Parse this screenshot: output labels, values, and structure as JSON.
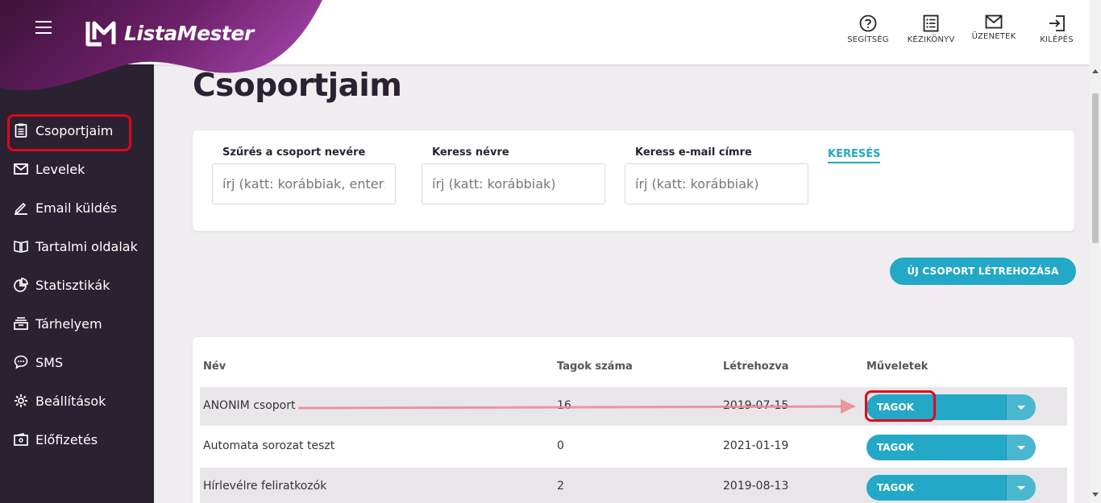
{
  "app": {
    "name": "ListaMester"
  },
  "header": {
    "actions": [
      {
        "label": "SEGÍTSÉG",
        "icon": "help-icon"
      },
      {
        "label": "KÉZIKÖNYV",
        "icon": "manual-icon"
      },
      {
        "label": "ÜZENETEK",
        "icon": "mail-icon"
      },
      {
        "label": "KILÉPÉS",
        "icon": "logout-icon"
      }
    ]
  },
  "sidebar": {
    "items": [
      {
        "label": "Csoportjaim",
        "icon": "clipboard-icon",
        "active": true
      },
      {
        "label": "Levelek",
        "icon": "envelope-icon"
      },
      {
        "label": "Email küldés",
        "icon": "pencil-icon"
      },
      {
        "label": "Tartalmi oldalak",
        "icon": "book-icon"
      },
      {
        "label": "Statisztikák",
        "icon": "pie-chart-icon"
      },
      {
        "label": "Tárhelyem",
        "icon": "storage-icon"
      },
      {
        "label": "SMS",
        "icon": "chat-icon"
      },
      {
        "label": "Beállítások",
        "icon": "gear-icon"
      },
      {
        "label": "Előfizetés",
        "icon": "wallet-icon"
      }
    ]
  },
  "page": {
    "title": "Csoportjaim"
  },
  "filters": {
    "group_name": {
      "label": "Szűrés a csoport nevére",
      "placeholder": "írj (katt: korábbiak, enter: új sor)"
    },
    "name": {
      "label": "Keress névre",
      "placeholder": "írj (katt: korábbiak)"
    },
    "email": {
      "label": "Keress e-mail címre",
      "placeholder": "írj (katt: korábbiak)"
    },
    "search_label": "KERESÉS"
  },
  "new_group_button": "ÚJ CSOPORT LÉTREHOZÁSA",
  "table": {
    "headers": [
      "Név",
      "Tagok száma",
      "Létrehozva",
      "Műveletek"
    ],
    "rows": [
      {
        "name": "ANONIM csoport",
        "members": "16",
        "created": "2019-07-15",
        "action": "TAGOK"
      },
      {
        "name": "Automata sorozat teszt",
        "members": "0",
        "created": "2021-01-19",
        "action": "TAGOK"
      },
      {
        "name": "Hírlevélre feliratkozók",
        "members": "2",
        "created": "2019-08-13",
        "action": "TAGOK"
      }
    ]
  },
  "colors": {
    "sidebar": "#2a2230",
    "accent": "#23a8c7",
    "highlight": "#e0061a",
    "brand_purple": "#7a2a7c"
  }
}
